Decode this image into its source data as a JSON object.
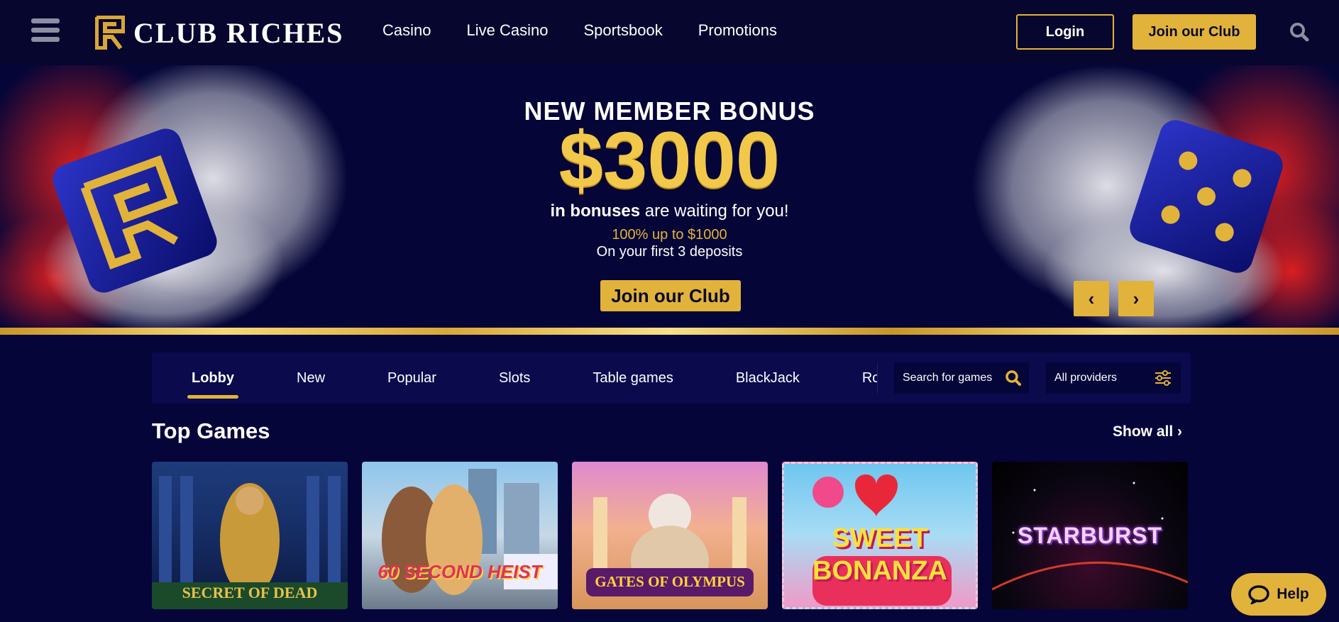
{
  "header": {
    "brand": "ClubRiches",
    "nav": [
      "Casino",
      "Live Casino",
      "Sportsbook",
      "Promotions"
    ],
    "login_label": "Login",
    "join_label": "Join our Club",
    "icons": {
      "menu": "hamburger-icon",
      "search": "search-icon"
    }
  },
  "hero": {
    "title": "NEW MEMBER BONUS",
    "amount": "$3000",
    "sub_bold": "in bonuses",
    "sub_rest": " are waiting for you!",
    "offer": "100% up to $1000",
    "deposits": "On your first 3 deposits",
    "cta_label": "Join our Club",
    "prev_label": "‹",
    "next_label": "›"
  },
  "catbar": {
    "tabs": [
      "Lobby",
      "New",
      "Popular",
      "Slots",
      "Table games",
      "BlackJack",
      "Roulette"
    ],
    "active_tab": "Lobby",
    "search_placeholder": "Search for games",
    "provider_label": "All providers"
  },
  "top_games": {
    "title": "Top Games",
    "show_all": "Show all",
    "games": [
      {
        "title": "SECRET OF DEAD"
      },
      {
        "title": "60 SECOND HEIST"
      },
      {
        "title": "GATES OF OLYMPUS"
      },
      {
        "title": "SWEET BONANZA"
      },
      {
        "title": "STARBURST"
      }
    ]
  },
  "help_label": "Help",
  "colors": {
    "accent": "#e2b33a",
    "background": "#05053a",
    "header": "#06062e",
    "panel": "#0a0a4d"
  }
}
